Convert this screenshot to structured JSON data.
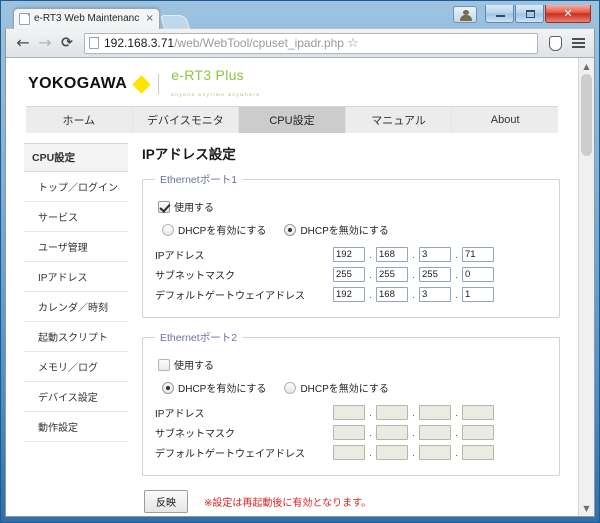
{
  "browser": {
    "tab_title": "e-RT3 Web Maintenanc",
    "tab_close": "×",
    "back_icon": "←",
    "forward_icon": "→",
    "reload_icon": "⟳",
    "url_host": "192.168.3.71",
    "url_path": "/web/WebTool/cpuset_ipadr.php",
    "star_icon": "☆",
    "window_close_glyph": "✕"
  },
  "site": {
    "brand": "YOKOGAWA",
    "product": "e-RT3 Plus",
    "tagline": "anyone  anytime  anywhere"
  },
  "navtabs": [
    {
      "label": "ホーム",
      "active": false
    },
    {
      "label": "デバイスモニタ",
      "active": false
    },
    {
      "label": "CPU設定",
      "active": true
    },
    {
      "label": "マニュアル",
      "active": false
    },
    {
      "label": "About",
      "active": false
    }
  ],
  "sidebar": {
    "header": "CPU設定",
    "items": [
      {
        "label": "トップ／ログイン"
      },
      {
        "label": "サービス"
      },
      {
        "label": "ユーザ管理"
      },
      {
        "label": "IPアドレス"
      },
      {
        "label": "カレンダ／時刻"
      },
      {
        "label": "起動スクリプト"
      },
      {
        "label": "メモリ／ログ"
      },
      {
        "label": "デバイス設定"
      },
      {
        "label": "動作設定"
      }
    ]
  },
  "main": {
    "title": "IPアドレス設定",
    "ports": [
      {
        "legend": "Ethernetポート1",
        "use_label": "使用する",
        "use_checked": true,
        "dhcp_enable_label": "DHCPを有効にする",
        "dhcp_disable_label": "DHCPを無効にする",
        "dhcp_selected": "disable",
        "fields": [
          {
            "label": "IPアドレス",
            "octets": [
              "192",
              "168",
              "3",
              "71"
            ],
            "disabled": false
          },
          {
            "label": "サブネットマスク",
            "octets": [
              "255",
              "255",
              "255",
              "0"
            ],
            "disabled": false
          },
          {
            "label": "デフォルトゲートウェイアドレス",
            "octets": [
              "192",
              "168",
              "3",
              "1"
            ],
            "disabled": false
          }
        ]
      },
      {
        "legend": "Ethernetポート2",
        "use_label": "使用する",
        "use_checked": false,
        "dhcp_enable_label": "DHCPを有効にする",
        "dhcp_disable_label": "DHCPを無効にする",
        "dhcp_selected": "enable",
        "fields": [
          {
            "label": "IPアドレス",
            "octets": [
              "",
              "",
              "",
              ""
            ],
            "disabled": true
          },
          {
            "label": "サブネットマスク",
            "octets": [
              "",
              "",
              "",
              ""
            ],
            "disabled": true
          },
          {
            "label": "デフォルトゲートウェイアドレス",
            "octets": [
              "",
              "",
              "",
              ""
            ],
            "disabled": true
          }
        ]
      }
    ],
    "apply_label": "反映",
    "note": "※設定は再起動後に有効となります。",
    "separator": "."
  },
  "colors": {
    "accent_green": "#8cc63f",
    "brand_yellow": "#ffe400",
    "legend_purple": "#6b6fa8",
    "note_red": "#e22121",
    "active_tab_bg": "#cccccc"
  }
}
